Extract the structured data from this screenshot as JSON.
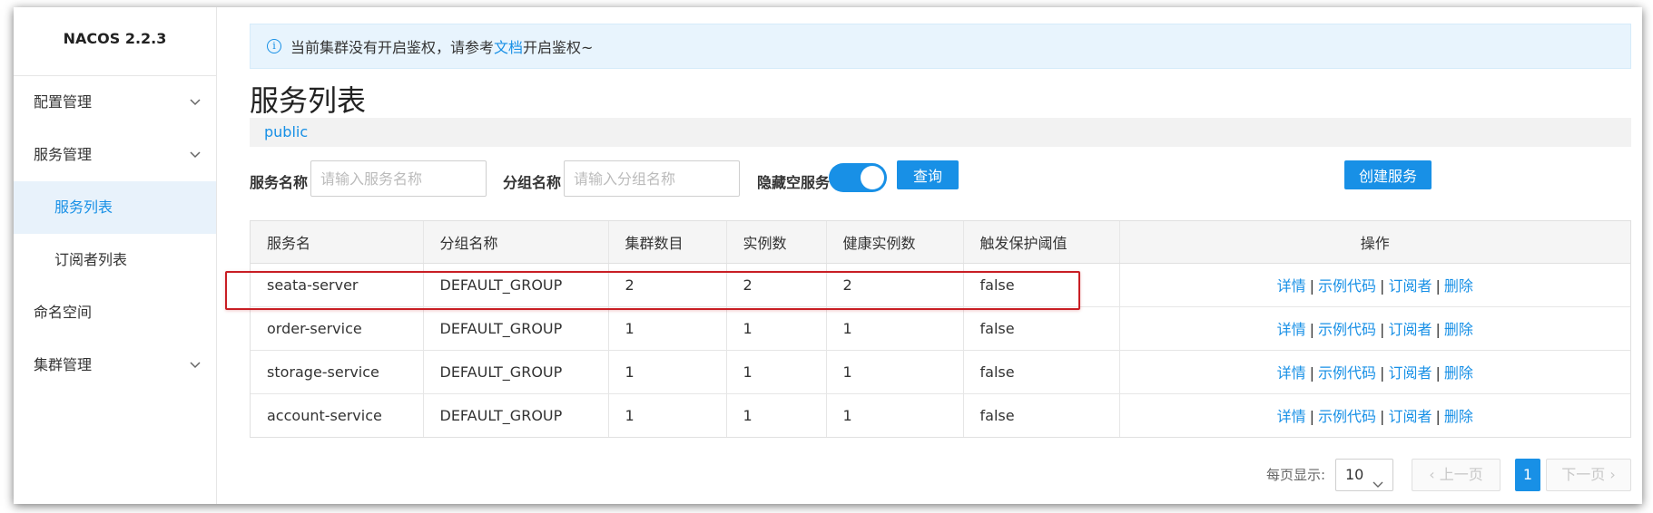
{
  "app": {
    "brand": "NACOS 2.2.3"
  },
  "sidebar": {
    "items": [
      {
        "label": "配置管理",
        "expandable": true
      },
      {
        "label": "服务管理",
        "expandable": true
      },
      {
        "label": "服务列表",
        "active": true
      },
      {
        "label": "订阅者列表"
      },
      {
        "label": "命名空间"
      },
      {
        "label": "集群管理",
        "expandable": true
      }
    ]
  },
  "alert": {
    "text_before": "当前集群没有开启鉴权，请参考",
    "link": "文档",
    "text_after": "开启鉴权~"
  },
  "page": {
    "title": "服务列表",
    "namespace": "public"
  },
  "filters": {
    "service_name_label": "服务名称",
    "service_name_placeholder": "请输入服务名称",
    "group_name_label": "分组名称",
    "group_name_placeholder": "请输入分组名称",
    "hide_empty_label": "隐藏空服务",
    "hide_empty_on": true,
    "query_button": "查询",
    "create_button": "创建服务"
  },
  "table": {
    "headers": [
      "服务名",
      "分组名称",
      "集群数目",
      "实例数",
      "健康实例数",
      "触发保护阈值",
      "操作"
    ],
    "rows": [
      [
        "seata-server",
        "DEFAULT_GROUP",
        "2",
        "2",
        "2",
        "false"
      ],
      [
        "order-service",
        "DEFAULT_GROUP",
        "1",
        "1",
        "1",
        "false"
      ],
      [
        "storage-service",
        "DEFAULT_GROUP",
        "1",
        "1",
        "1",
        "false"
      ],
      [
        "account-service",
        "DEFAULT_GROUP",
        "1",
        "1",
        "1",
        "false"
      ]
    ],
    "actions": [
      "详情",
      "示例代码",
      "订阅者",
      "删除"
    ],
    "separator": "|"
  },
  "pagination": {
    "page_size_label": "每页显示:",
    "page_size": "10",
    "prev": "上一页",
    "next": "下一页",
    "current_page": "1"
  },
  "colors": {
    "accent": "#1890e6",
    "highlight": "#c81e24"
  }
}
